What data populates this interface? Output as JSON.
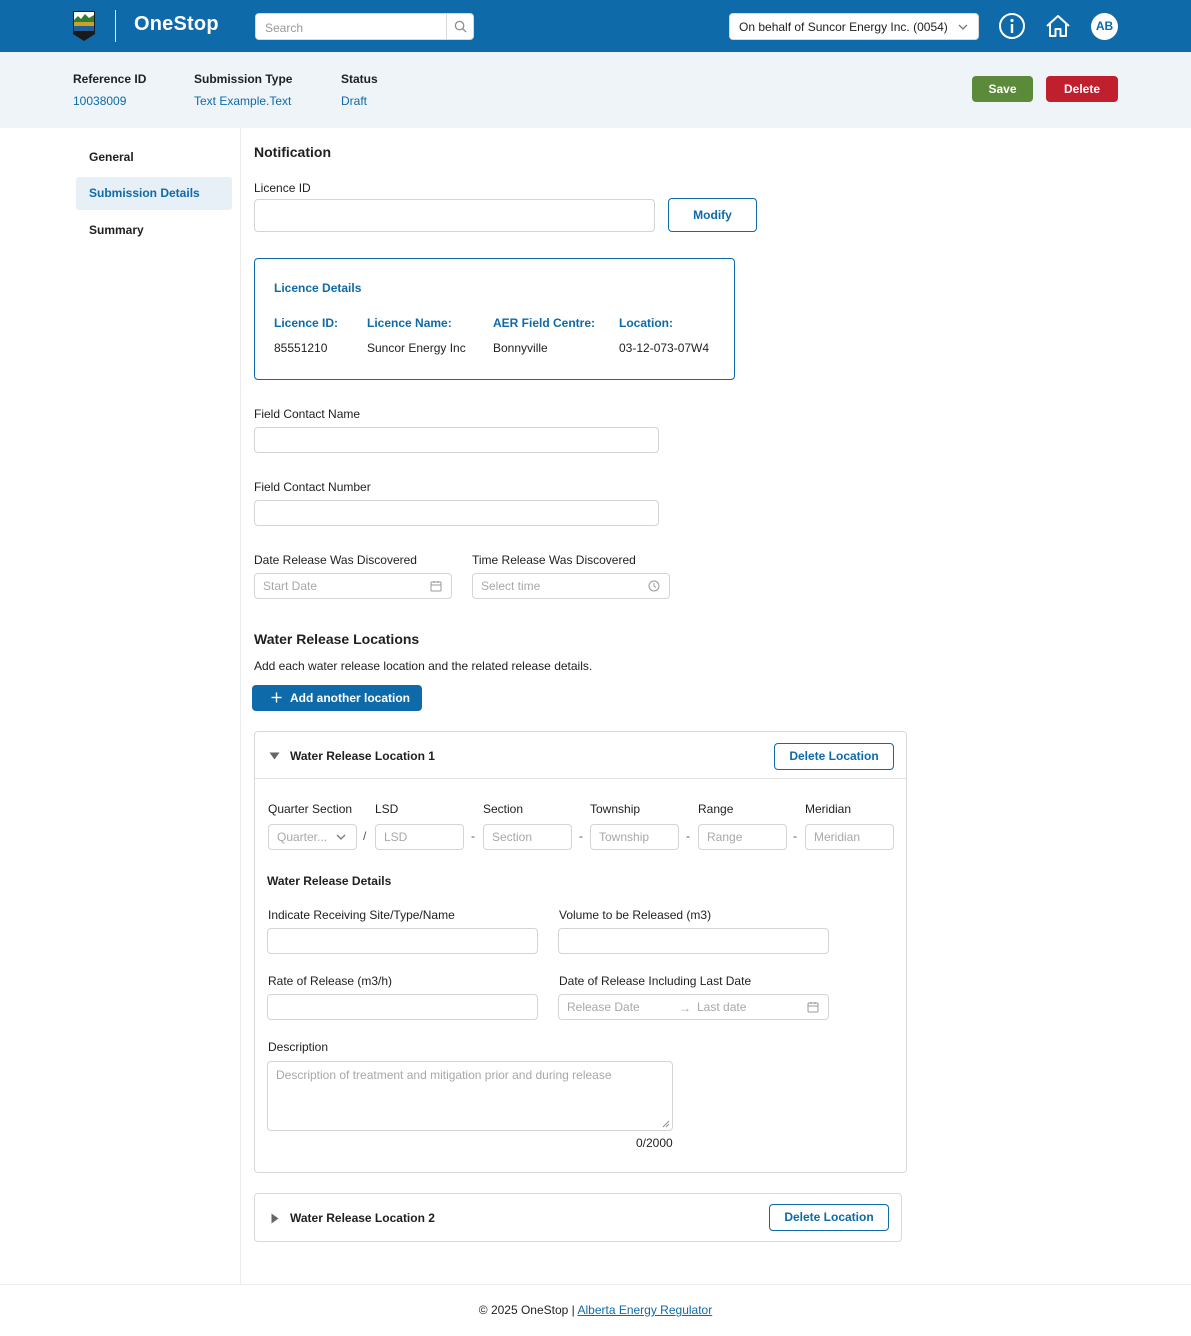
{
  "header": {
    "app_name": "OneStop",
    "search_placeholder": "Search",
    "behalf": "On behalf of Suncor Energy Inc. (0054)",
    "avatar_initials": "AB",
    "icons": [
      "search-icon",
      "chevron-down-icon",
      "info-icon",
      "home-icon"
    ]
  },
  "submission": {
    "ref_label": "Reference ID",
    "ref_value": "10038009",
    "type_label": "Submission Type",
    "type_value": "Text Example.Text",
    "status_label": "Status",
    "status_value": "Draft",
    "save": "Save",
    "delete": "Delete"
  },
  "sidebar": {
    "items": [
      {
        "label": "General",
        "active": false
      },
      {
        "label": "Submission Details",
        "active": true
      },
      {
        "label": "Summary",
        "active": false
      }
    ]
  },
  "notification": {
    "title": "Notification",
    "licence_id_label": "Licence ID",
    "licence_id_value": "",
    "modify": "Modify"
  },
  "licence_details": {
    "title": "Licence Details",
    "id_label": "Licence ID:",
    "id_value": "85551210",
    "name_label": "Licence Name:",
    "name_value": "Suncor Energy Inc",
    "centre_label": "AER Field Centre:",
    "centre_value": "Bonnyville",
    "location_label": "Location:",
    "location_value": "03-12-073-07W4"
  },
  "contact": {
    "name_label": "Field Contact Name",
    "number_label": "Field Contact Number",
    "date_label": "Date Release Was Discovered",
    "date_placeholder": "Start Date",
    "time_label": "Time Release Was Discovered",
    "time_placeholder": "Select time"
  },
  "water": {
    "title": "Water Release Locations",
    "desc": "Add each water release location and the related release details.",
    "add_button": "Add another location"
  },
  "location1": {
    "title": "Water Release Location 1",
    "delete": "Delete Location",
    "expanded": true,
    "qs_label": "Quarter Section",
    "qs_placeholder": "Quarter...",
    "lsd_label": "LSD",
    "lsd_placeholder": "LSD",
    "section_label": "Section",
    "section_placeholder": "Section",
    "township_label": "Township",
    "township_placeholder": "Township",
    "range_label": "Range",
    "range_placeholder": "Range",
    "meridian_label": "Meridian",
    "meridian_placeholder": "Meridian",
    "sep_slash": "/",
    "sep_dash": "-",
    "details_title": "Water Release Details",
    "site_label": "Indicate Receiving Site/Type/Name",
    "volume_label": "Volume to be Released (m3)",
    "rate_label": "Rate of Release (m3/h)",
    "date_label": "Date of Release Including Last Date",
    "release_date_placeholder": "Release Date",
    "last_date_placeholder": "Last date",
    "arrow": "→",
    "description_label": "Description",
    "description_placeholder": "Description of treatment and mitigation prior and during release",
    "char_count": "0/2000"
  },
  "location2": {
    "title": "Water Release Location 2",
    "delete": "Delete Location",
    "expanded": false
  },
  "footer": {
    "copyright": "© 2025 OneStop | ",
    "link": "Alberta Energy Regulator"
  },
  "colors": {
    "brand_blue": "#0e6aa8",
    "save_green": "#5a8a3a",
    "delete_red": "#c01f2d"
  }
}
